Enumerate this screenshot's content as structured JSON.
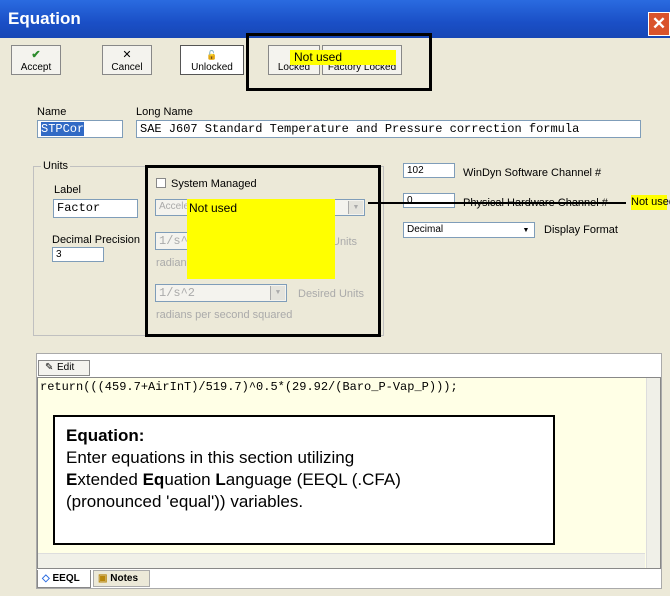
{
  "window": {
    "title": "Equation",
    "close_glyph": "✕"
  },
  "toolbar": [
    {
      "label": "Accept",
      "icon": "✔",
      "icon_name": "checkmark-icon"
    },
    {
      "label": "Cancel",
      "icon": "✕",
      "icon_name": "x-icon"
    },
    {
      "label": "Unlocked",
      "icon": "🔓",
      "icon_name": "unlocked-icon"
    },
    {
      "label": "Locked",
      "icon": "🔒",
      "icon_name": "locked-icon"
    },
    {
      "label": "Factory Locked",
      "icon": "🔒",
      "icon_name": "factory-locked-icon"
    }
  ],
  "callouts": {
    "toolbar_not_used": "Not used",
    "units_not_used": "Not used",
    "hardware_not_used": "Not used"
  },
  "name": {
    "label": "Name",
    "value": "STPCor"
  },
  "long_name": {
    "label": "Long Name",
    "value": "SAE J607 Standard Temperature and Pressure correction formula"
  },
  "units": {
    "group_label": "Units",
    "label_caption": "Label",
    "label_value": "Factor",
    "decimal_precision_caption": "Decimal Precision",
    "decimal_precision_value": "3",
    "system_managed": "System Managed",
    "category_value": "Accele",
    "base_unit_value": "1/s^",
    "base_units_caption": "Units",
    "base_unit_desc": "radians",
    "desired_unit_value": "1/s^2",
    "desired_units_caption": "Desired Units",
    "desired_unit_desc": "radians per second squared"
  },
  "channels": {
    "software_value": "102",
    "software_label": "WinDyn Software Channel #",
    "hardware_value": "0",
    "hardware_label": "Physical Hardware Channel #",
    "display_format_value": "Decimal",
    "display_format_label": "Display Format"
  },
  "editor": {
    "edit_button": "Edit",
    "code": "return(((459.7+AirInT)/519.7)^0.5*(29.92/(Baro_P-Vap_P)));"
  },
  "note": {
    "title": "Equation:",
    "line1": "Enter equations in this section utilizing",
    "line2_bold1": "E",
    "line2_rest1": "xtended ",
    "line2_bold2": "Eq",
    "line2_rest2": "uation ",
    "line2_bold3": "L",
    "line2_rest3": "anguage (EEQL (.CFA)",
    "line3": "(pronounced 'equal')) variables."
  },
  "tabs": [
    {
      "label": "EEQL"
    },
    {
      "label": "Notes"
    }
  ],
  "colors": {
    "titlebar": "#1a4fc6",
    "callout": "#ffff00",
    "editor_bg": "#ffffe6"
  }
}
